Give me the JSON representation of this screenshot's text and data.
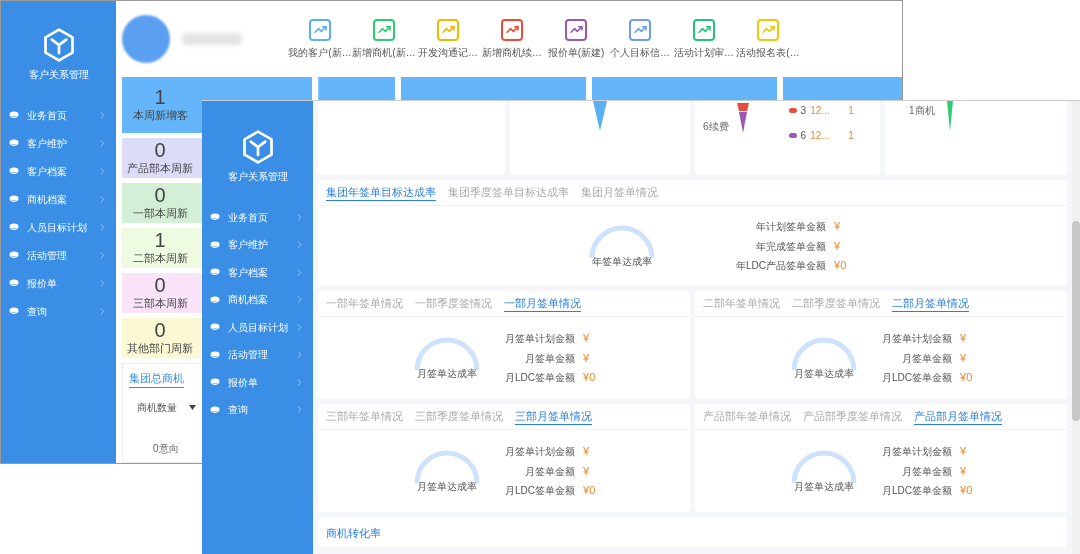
{
  "back_window": {
    "sidebar": {
      "title": "客户关系管理",
      "items": [
        "业务首页",
        "客户维护",
        "客户档案",
        "商机档案",
        "人员目标计划",
        "活动管理",
        "报价单",
        "查询"
      ]
    },
    "shortcuts": [
      {
        "label": "我的客户(新…",
        "color": "#5ab1ef"
      },
      {
        "label": "新增商机(新…",
        "color": "#2ecc71"
      },
      {
        "label": "开发沟通记…",
        "color": "#f5b800"
      },
      {
        "label": "新增商机续…",
        "color": "#e74c3c"
      },
      {
        "label": "报价单(新建)",
        "color": "#9b59b6"
      },
      {
        "label": "个人目标信…",
        "color": "#6f9bf7"
      },
      {
        "label": "活动计划审…",
        "color": "#27c27a"
      },
      {
        "label": "活动报名表(…",
        "color": "#f0c808"
      }
    ],
    "dept_stats": [
      {
        "value": "1",
        "label": "本周新增客",
        "color": "#64b5fa"
      },
      {
        "value": "0",
        "label": "产品部本周新",
        "color": "#dcdcf9"
      },
      {
        "value": "0",
        "label": "一部本周新",
        "color": "#d3efd6"
      },
      {
        "value": "1",
        "label": "二部本周新",
        "color": "#eefbe0"
      },
      {
        "value": "0",
        "label": "三部本周新",
        "color": "#f8e3f8"
      },
      {
        "value": "0",
        "label": "其他部门周新",
        "color": "#fcf8d4"
      }
    ],
    "opportunity_card": {
      "title": "集团总商机",
      "dropdown": "商机数量",
      "chart_label": "0意向"
    }
  },
  "front_window": {
    "sidebar": {
      "title": "客户关系管理",
      "items": [
        "业务首页",
        "客户维护",
        "客户档案",
        "商机档案",
        "人员目标计划",
        "活动管理",
        "报价单",
        "查询"
      ]
    },
    "funnel": {
      "label": "6续费",
      "legend": [
        {
          "number": "3",
          "text": "12...",
          "count": "1",
          "color": "#e74c3c"
        },
        {
          "number": "6",
          "text": "12...",
          "count": "1",
          "color": "#9b59b6"
        }
      ]
    },
    "opportunity_label": "1商机",
    "group_section": {
      "tabs": [
        {
          "label": "集团年签单目标达成率",
          "selected": true
        },
        {
          "label": "集团季度签单目标达成率",
          "selected": false
        },
        {
          "label": "集团月签单情况",
          "selected": false
        }
      ],
      "gauge_label": "年签单达成率",
      "stats": [
        {
          "label": "年计划签单金额",
          "value": "¥"
        },
        {
          "label": "年完成签单金额",
          "value": "¥"
        },
        {
          "label": "年LDC产品签单金额",
          "value": "¥0"
        }
      ]
    },
    "dept_sections": [
      {
        "tabs": [
          {
            "label": "一部年签单情况",
            "selected": false
          },
          {
            "label": "一部季度签情况",
            "selected": false
          },
          {
            "label": "一部月签单情况",
            "selected": true
          }
        ],
        "gauge_label": "月签单达成率",
        "stats": [
          {
            "label": "月签单计划金额",
            "value": "¥"
          },
          {
            "label": "月签单金额",
            "value": "¥"
          },
          {
            "label": "月LDC签单金额",
            "value": "¥0"
          }
        ]
      },
      {
        "tabs": [
          {
            "label": "二部年签单情况",
            "selected": false
          },
          {
            "label": "二部季度签单情况",
            "selected": false
          },
          {
            "label": "二部月签单情况",
            "selected": true
          }
        ],
        "gauge_label": "月签单达成率",
        "stats": [
          {
            "label": "月签单计划金额",
            "value": "¥"
          },
          {
            "label": "月签单金额",
            "value": "¥"
          },
          {
            "label": "月LDC签单金额",
            "value": "¥0"
          }
        ]
      },
      {
        "tabs": [
          {
            "label": "三部年签单情况",
            "selected": false
          },
          {
            "label": "三部季度签单情况",
            "selected": false
          },
          {
            "label": "三部月签单情况",
            "selected": true
          }
        ],
        "gauge_label": "月签单达成率",
        "stats": [
          {
            "label": "月签单计划金额",
            "value": "¥"
          },
          {
            "label": "月签单金额",
            "value": "¥"
          },
          {
            "label": "月LDC签单金额",
            "value": "¥0"
          }
        ]
      },
      {
        "tabs": [
          {
            "label": "产品部年签单情况",
            "selected": false
          },
          {
            "label": "产品部季度签单情况",
            "selected": false
          },
          {
            "label": "产品部月签单情况",
            "selected": true
          }
        ],
        "gauge_label": "月签单达成率",
        "stats": [
          {
            "label": "月签单计划金额",
            "value": "¥"
          },
          {
            "label": "月签单金额",
            "value": "¥"
          },
          {
            "label": "月LDC签单金额",
            "value": "¥0"
          }
        ]
      }
    ],
    "bottom_title": "商机转化率"
  }
}
